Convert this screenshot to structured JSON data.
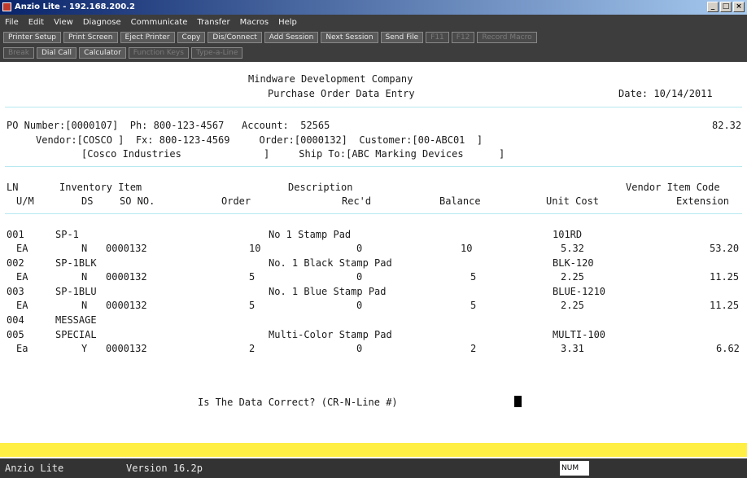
{
  "window": {
    "title": "Anzio Lite - 192.168.200.2"
  },
  "menu": [
    "File",
    "Edit",
    "View",
    "Diagnose",
    "Communicate",
    "Transfer",
    "Macros",
    "Help"
  ],
  "toolbar": {
    "row1": [
      "Printer Setup",
      "Print Screen",
      "Eject Printer",
      "Copy",
      "Dis/Connect",
      "Add Session",
      "Next Session",
      "Send File",
      "F11",
      "F12",
      "Record Macro"
    ],
    "row2": [
      "Break",
      "Dial Call",
      "Calculator",
      "Function Keys",
      "Type-a-Line"
    ]
  },
  "screen": {
    "company": "Mindware Development Company",
    "subtitle": "Purchase Order Data Entry",
    "date": "Date: 10/14/2011",
    "po_line1": "PO Number:[0000107]  Ph: 800-123-4567   Account:  52565",
    "po_amount": "82.32",
    "po_line2": "Vendor:[COSCO ]  Fx: 800-123-4569     Order:[0000132]  Customer:[00-ABC01  ]",
    "po_line3": "[Cosco Industries              ]     Ship To:[ABC Marking Devices      ]",
    "headers": {
      "ln": "LN",
      "inv_item": "Inventory Item",
      "description": "Description",
      "vendor_item_code": "Vendor Item Code",
      "um": "U/M",
      "ds": "DS",
      "so_no": "SO NO.",
      "order": "Order",
      "recd": "Rec'd",
      "balance": "Balance",
      "unit_cost": "Unit Cost",
      "extension": "Extension"
    },
    "lines": [
      {
        "ln": "001",
        "item": "SP-1",
        "desc": "No 1 Stamp Pad",
        "vcode": "101RD",
        "um": "EA",
        "ds": "N",
        "so": "0000132",
        "order": "10",
        "recd": "0",
        "bal": "10",
        "cost": "5.32",
        "ext": "53.20"
      },
      {
        "ln": "002",
        "item": "SP-1BLK",
        "desc": "No. 1 Black Stamp Pad",
        "vcode": "BLK-120",
        "um": "EA",
        "ds": "N",
        "so": "0000132",
        "order": "5",
        "recd": "0",
        "bal": "5",
        "cost": "2.25",
        "ext": "11.25"
      },
      {
        "ln": "003",
        "item": "SP-1BLU",
        "desc": "No. 1 Blue Stamp Pad",
        "vcode": "BLUE-1210",
        "um": "EA",
        "ds": "N",
        "so": "0000132",
        "order": "5",
        "recd": "0",
        "bal": "5",
        "cost": "2.25",
        "ext": "11.25"
      },
      {
        "ln": "004",
        "item": "MESSAGE"
      },
      {
        "ln": "005",
        "item": "SPECIAL",
        "desc": "Multi-Color Stamp Pad",
        "vcode": "MULTI-100",
        "um": "Ea",
        "ds": "Y",
        "so": "0000132",
        "order": "2",
        "recd": "0",
        "bal": "2",
        "cost": "3.31",
        "ext": "6.62"
      }
    ],
    "prompt": "Is The Data Correct? (CR-N-Line #)"
  },
  "status": {
    "app": "Anzio Lite",
    "version": "Version 16.2p",
    "num": "NUM"
  },
  "colors": {
    "yellow_bar": "#ffee44",
    "separator": "#b8e8f0",
    "status_bg": "#333333"
  }
}
